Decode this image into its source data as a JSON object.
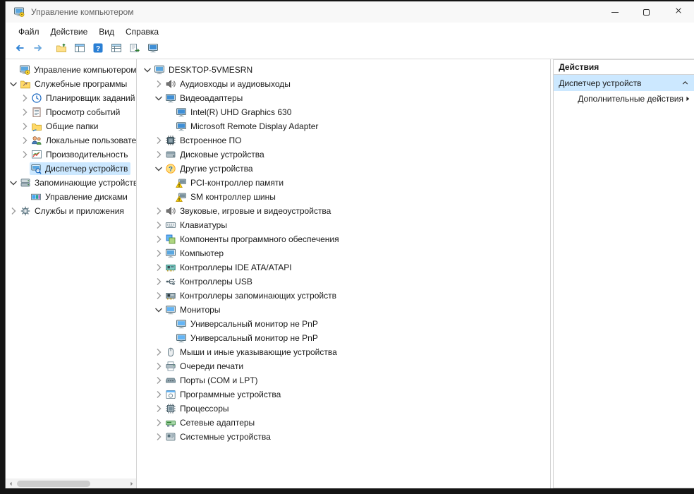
{
  "window": {
    "title": "Управление компьютером",
    "app_icon": "computer-management",
    "controls": [
      {
        "name": "minimize"
      },
      {
        "name": "maximize"
      },
      {
        "name": "close"
      }
    ]
  },
  "menubar": {
    "items": [
      {
        "name": "file",
        "label": "Файл"
      },
      {
        "name": "action",
        "label": "Действие"
      },
      {
        "name": "view",
        "label": "Вид"
      },
      {
        "name": "help",
        "label": "Справка"
      }
    ]
  },
  "toolbar": {
    "buttons": [
      {
        "name": "back",
        "icon": "arrow-back"
      },
      {
        "name": "forward",
        "icon": "arrow-forward"
      },
      {
        "name": "show-console-tree",
        "icon": "console-window"
      },
      {
        "name": "properties",
        "icon": "properties-table"
      },
      {
        "name": "help",
        "icon": "help"
      },
      {
        "name": "export-list",
        "icon": "list-table"
      },
      {
        "name": "action-pane",
        "icon": "export-arrow"
      },
      {
        "name": "remote-screen",
        "icon": "screen"
      }
    ]
  },
  "left_tree": {
    "items": [
      {
        "label": "Управление компьютером",
        "icon": "computer-management",
        "indent": 0,
        "chevron": "none"
      },
      {
        "label": "Служебные программы",
        "icon": "folder-tools",
        "indent": 0,
        "chevron": "down"
      },
      {
        "label": "Планировщик заданий",
        "icon": "task-scheduler",
        "indent": 1,
        "chevron": "right"
      },
      {
        "label": "Просмотр событий",
        "icon": "event-viewer",
        "indent": 1,
        "chevron": "right"
      },
      {
        "label": "Общие папки",
        "icon": "shared-folders",
        "indent": 1,
        "chevron": "right"
      },
      {
        "label": "Локальные пользователи и группы",
        "icon": "local-users",
        "indent": 1,
        "chevron": "right"
      },
      {
        "label": "Производительность",
        "icon": "performance",
        "indent": 1,
        "chevron": "right"
      },
      {
        "label": "Диспетчер устройств",
        "icon": "device-manager",
        "indent": 1,
        "chevron": "none",
        "selected": true
      },
      {
        "label": "Запоминающие устройства",
        "icon": "storage-devices",
        "indent": 0,
        "chevron": "down"
      },
      {
        "label": "Управление дисками",
        "icon": "disk-management",
        "indent": 1,
        "chevron": "none"
      },
      {
        "label": "Службы и приложения",
        "icon": "services",
        "indent": 0,
        "chevron": "right"
      }
    ]
  },
  "device_tree": {
    "items": [
      {
        "label": "DESKTOP-5VMESRN",
        "icon": "computer",
        "indent": 0,
        "chevron": "down"
      },
      {
        "label": "Аудиовходы и аудиовыходы",
        "icon": "audio",
        "indent": 1,
        "chevron": "right"
      },
      {
        "label": "Видеоадаптеры",
        "icon": "display-adapter",
        "indent": 1,
        "chevron": "down"
      },
      {
        "label": "Intel(R) UHD Graphics 630",
        "icon": "display-adapter",
        "indent": 2,
        "chevron": "none"
      },
      {
        "label": "Microsoft Remote Display Adapter",
        "icon": "display-adapter",
        "indent": 2,
        "chevron": "none"
      },
      {
        "label": "Встроенное ПО",
        "icon": "firmware",
        "indent": 1,
        "chevron": "right"
      },
      {
        "label": "Дисковые устройства",
        "icon": "disk-drive",
        "indent": 1,
        "chevron": "right"
      },
      {
        "label": "Другие устройства",
        "icon": "other-devices",
        "indent": 1,
        "chevron": "down"
      },
      {
        "label": "PCI-контроллер памяти",
        "icon": "device-warning",
        "indent": 2,
        "chevron": "none"
      },
      {
        "label": "SM контроллер шины",
        "icon": "device-warning",
        "indent": 2,
        "chevron": "none"
      },
      {
        "label": "Звуковые, игровые и видеоустройства",
        "icon": "sound-game",
        "indent": 1,
        "chevron": "right"
      },
      {
        "label": "Клавиатуры",
        "icon": "keyboard",
        "indent": 1,
        "chevron": "right"
      },
      {
        "label": "Компоненты программного обеспечения",
        "icon": "software-component",
        "indent": 1,
        "chevron": "right"
      },
      {
        "label": "Компьютер",
        "icon": "computer",
        "indent": 1,
        "chevron": "right"
      },
      {
        "label": "Контроллеры IDE ATA/ATAPI",
        "icon": "ide-controller",
        "indent": 1,
        "chevron": "right"
      },
      {
        "label": "Контроллеры USB",
        "icon": "usb-controller",
        "indent": 1,
        "chevron": "right"
      },
      {
        "label": "Контроллеры запоминающих устройств",
        "icon": "storage-controller",
        "indent": 1,
        "chevron": "right"
      },
      {
        "label": "Мониторы",
        "icon": "monitor",
        "indent": 1,
        "chevron": "down"
      },
      {
        "label": "Универсальный монитор не PnP",
        "icon": "monitor",
        "indent": 2,
        "chevron": "none"
      },
      {
        "label": "Универсальный монитор не PnP",
        "icon": "monitor",
        "indent": 2,
        "chevron": "none"
      },
      {
        "label": "Мыши и иные указывающие устройства",
        "icon": "mouse",
        "indent": 1,
        "chevron": "right"
      },
      {
        "label": "Очереди печати",
        "icon": "printer",
        "indent": 1,
        "chevron": "right"
      },
      {
        "label": "Порты (COM и LPT)",
        "icon": "ports",
        "indent": 1,
        "chevron": "right"
      },
      {
        "label": "Программные устройства",
        "icon": "software-device",
        "indent": 1,
        "chevron": "right"
      },
      {
        "label": "Процессоры",
        "icon": "processor",
        "indent": 1,
        "chevron": "right"
      },
      {
        "label": "Сетевые адаптеры",
        "icon": "network-adapter",
        "indent": 1,
        "chevron": "right"
      },
      {
        "label": "Системные устройства",
        "icon": "system-device",
        "indent": 1,
        "chevron": "right"
      }
    ]
  },
  "actions": {
    "title": "Действия",
    "section_header": {
      "label": "Диспетчер устройств",
      "collapse_icon": "chevron-up"
    },
    "items": [
      {
        "label": "Дополнительные действия",
        "arrow": "flyout-right"
      }
    ]
  },
  "colors": {
    "selection": "#cce8ff",
    "accent_blue": "#2a7fd4",
    "warning_yellow": "#ffd600"
  }
}
